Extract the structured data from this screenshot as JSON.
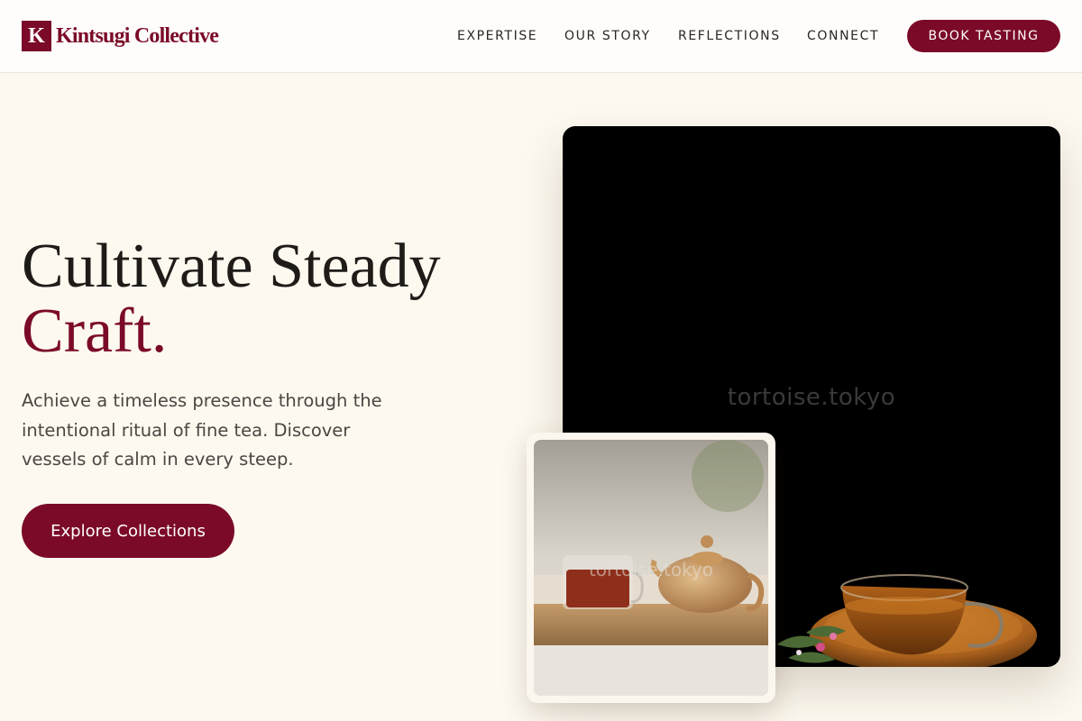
{
  "header": {
    "logo_mark": "K",
    "brand": "Kintsugi Collective",
    "nav": [
      "EXPERTISE",
      "OUR STORY",
      "REFLECTIONS",
      "CONNECT"
    ],
    "cta_label": "BOOK TASTING"
  },
  "hero": {
    "headline_line1": "Cultivate Steady",
    "headline_line2": "Craft.",
    "subcopy": "Achieve a timeless presence through the intentional ritual of fine tea. Discover vessels of calm in every steep.",
    "button_label": "Explore Collections"
  },
  "images": {
    "main_watermark": "tortoise.tokyo",
    "inset_watermark": "tortoise.tokyo"
  },
  "colors": {
    "brand": "#7b0a28",
    "background": "#fdf9ef",
    "header_background": "#fefdfb",
    "text": "#1e1b18",
    "muted_text": "#4b4641"
  }
}
